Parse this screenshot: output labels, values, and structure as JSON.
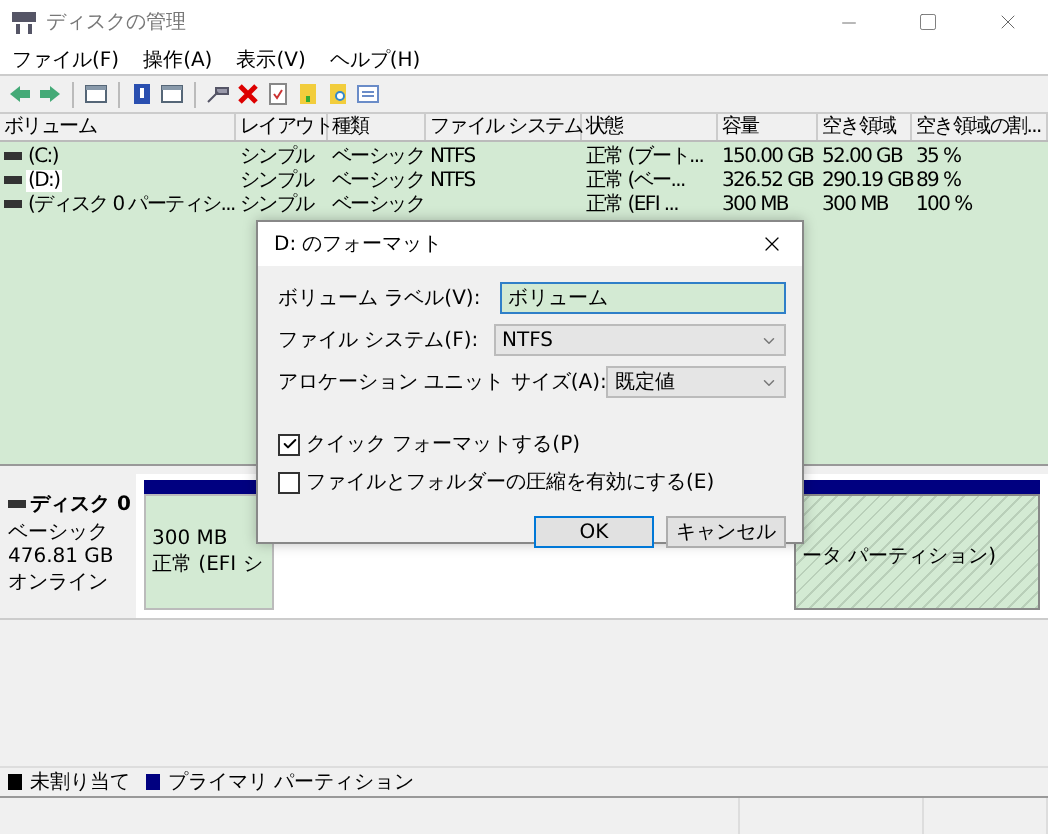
{
  "window": {
    "title": "ディスクの管理"
  },
  "menu": [
    "ファイル(F)",
    "操作(A)",
    "表示(V)",
    "ヘルプ(H)"
  ],
  "table": {
    "columns": [
      "ボリューム",
      "レイアウト",
      "種類",
      "ファイル システム",
      "状態",
      "容量",
      "空き領域",
      "空き領域の割..."
    ],
    "rows": [
      {
        "selected": false,
        "cells": [
          "(C:)",
          "シンプル",
          "ベーシック",
          "NTFS",
          "正常 (ブート...",
          "150.00 GB",
          "52.00 GB",
          "35 %"
        ]
      },
      {
        "selected": true,
        "cells": [
          "(D:)",
          "シンプル",
          "ベーシック",
          "NTFS",
          "正常 (ベー...",
          "326.52 GB",
          "290.19 GB",
          "89 %"
        ]
      },
      {
        "selected": false,
        "cells": [
          "(ディスク 0 パーティシ...",
          "シンプル",
          "ベーシック",
          "",
          "正常 (EFI ...",
          "300 MB",
          "300 MB",
          "100 %"
        ]
      }
    ]
  },
  "disk": {
    "name": "ディスク 0",
    "type": "ベーシック",
    "size": "476.81 GB",
    "status": "オンライン",
    "partitions": [
      {
        "kind": "plain",
        "size": "300 MB",
        "status": "正常 (EFI シ"
      },
      {
        "kind": "hatched",
        "status": "ータ パーティション)"
      }
    ]
  },
  "legend": [
    {
      "label": "未割り当て",
      "color": "#000000"
    },
    {
      "label": "プライマリ パーティション",
      "color": "#000080"
    }
  ],
  "dialog": {
    "title": "D: のフォーマット",
    "fields": [
      {
        "kind": "text",
        "label": "ボリューム ラベル(V):",
        "value": "ボリューム"
      },
      {
        "kind": "select",
        "label": "ファイル システム(F):",
        "value": "NTFS"
      },
      {
        "kind": "select",
        "label": "アロケーション ユニット サイズ(A):",
        "value": "既定値"
      }
    ],
    "checkboxes": [
      {
        "label": "クイック フォーマットする(P)",
        "checked": true
      },
      {
        "label": "ファイルとフォルダーの圧縮を有効にする(E)",
        "checked": false
      }
    ],
    "buttons": [
      {
        "label": "OK",
        "default": true
      },
      {
        "label": "キャンセル",
        "default": false
      }
    ]
  }
}
